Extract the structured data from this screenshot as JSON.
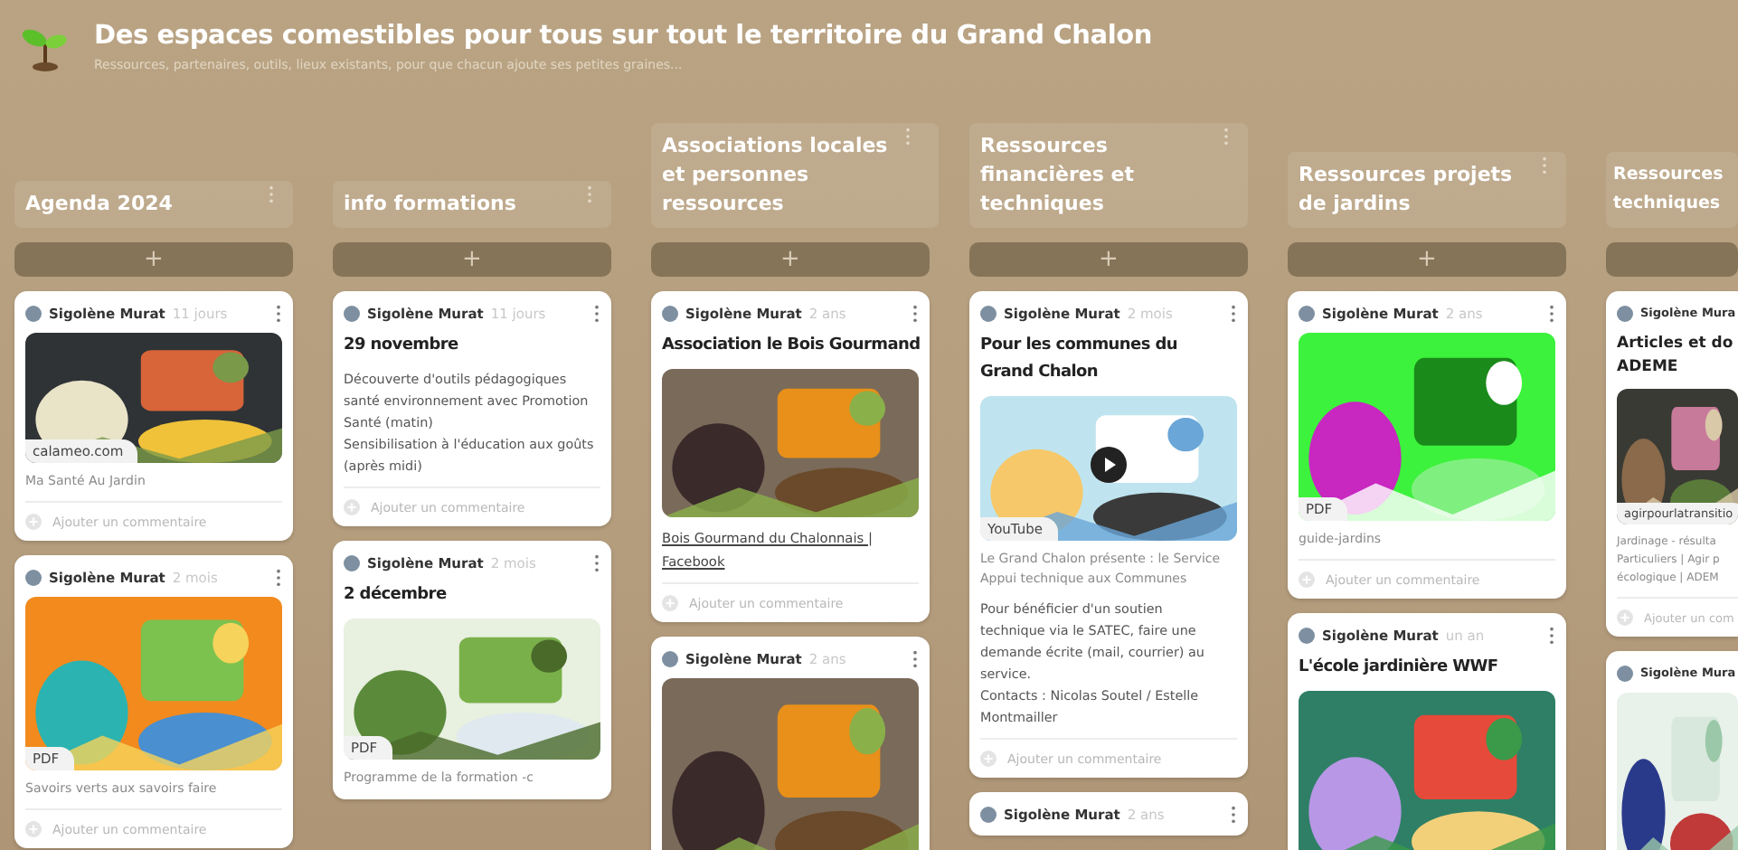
{
  "board": {
    "title": "Des espaces comestibles pour tous sur tout le territoire du Grand Chalon",
    "description": "Ressources, partenaires, outils, lieux existants, pour que chacun ajoute ses petites graines..."
  },
  "columns": [
    {
      "title": [
        "Agenda 2024"
      ],
      "add": "+",
      "posts": [
        {
          "author": "Sigolène Murat",
          "time": "11 jours",
          "media": {
            "kind": "picture",
            "chip": "calameo.com"
          },
          "caption": [
            "Ma Santé Au Jardin"
          ],
          "comment": "Ajouter un commentaire"
        },
        {
          "author": "Sigolène Murat",
          "time": "2 mois",
          "media": {
            "kind": "picture",
            "chip": "PDF"
          },
          "caption": [
            "Savoirs verts aux savoirs faire"
          ],
          "comment": "Ajouter un commentaire"
        }
      ]
    },
    {
      "title": [
        "info formations"
      ],
      "add": "+",
      "posts": [
        {
          "author": "Sigolène Murat",
          "time": "11 jours",
          "title": [
            "29 novembre"
          ],
          "body": [
            "Découverte d'outils pédagogiques",
            "santé environnement avec Promotion",
            "Santé (matin)",
            "Sensibilisation à l'éducation aux goûts",
            "(après midi)"
          ],
          "comment": "Ajouter un commentaire"
        },
        {
          "author": "Sigolène Murat",
          "time": "2 mois",
          "title": [
            "2 décembre"
          ],
          "media": {
            "kind": "picture",
            "chip": "PDF"
          },
          "caption": [
            "Programme de la formation -c"
          ]
        }
      ]
    },
    {
      "title": [
        "Associations locales",
        "et personnes",
        "ressources"
      ],
      "add": "+",
      "posts": [
        {
          "author": "Sigolène Murat",
          "time": "2 ans",
          "title": [
            "Association le Bois Gourmand"
          ],
          "media": {
            "kind": "picture"
          },
          "link": [
            "Bois Gourmand du Chalonnais |",
            "Facebook"
          ],
          "comment": "Ajouter un commentaire"
        },
        {
          "author": "Sigolène Murat",
          "time": "2 ans",
          "media": {
            "kind": "picture"
          }
        }
      ]
    },
    {
      "title": [
        "Ressources",
        "financières et",
        "techniques"
      ],
      "add": "+",
      "posts": [
        {
          "author": "Sigolène Murat",
          "time": "2 mois",
          "title": [
            "Pour les communes du",
            "Grand Chalon"
          ],
          "media": {
            "kind": "picture",
            "chip": "YouTube",
            "video": true
          },
          "caption": [
            "Le Grand Chalon présente : le Service",
            "Appui technique aux Communes"
          ],
          "body": [
            "Pour bénéficier d'un soutien",
            "technique via le SATEC, faire une",
            "demande écrite (mail, courrier) au",
            "service.",
            "Contacts : Nicolas Soutel / Estelle",
            "Montmailler"
          ],
          "comment": "Ajouter un commentaire"
        },
        {
          "author": "Sigolène Murat",
          "time": "2 ans"
        }
      ]
    },
    {
      "title": [
        "Ressources projets",
        "de jardins"
      ],
      "add": "+",
      "posts": [
        {
          "author": "Sigolène Murat",
          "time": "2 ans",
          "media": {
            "kind": "picture",
            "chip": "PDF"
          },
          "caption": [
            "guide-jardins"
          ],
          "comment": "Ajouter un commentaire"
        },
        {
          "author": "Sigolène Murat",
          "time": "un an",
          "title": [
            "L'école jardinière WWF"
          ],
          "media": {
            "kind": "picture"
          }
        }
      ]
    },
    {
      "title": [
        "Ressources",
        "techniques"
      ],
      "posts": [
        {
          "author": "Sigolène Mura",
          "title": [
            "Articles et do",
            "ADEME"
          ],
          "media": {
            "kind": "picture",
            "chip": "agirpourlatransitio"
          },
          "caption": [
            "Jardinage - résulta",
            "Particuliers | Agir p",
            "écologique | ADEM"
          ],
          "comment": "Ajouter un com"
        },
        {
          "author": "Sigolène Mura",
          "media": {
            "kind": "picture"
          }
        }
      ]
    }
  ]
}
